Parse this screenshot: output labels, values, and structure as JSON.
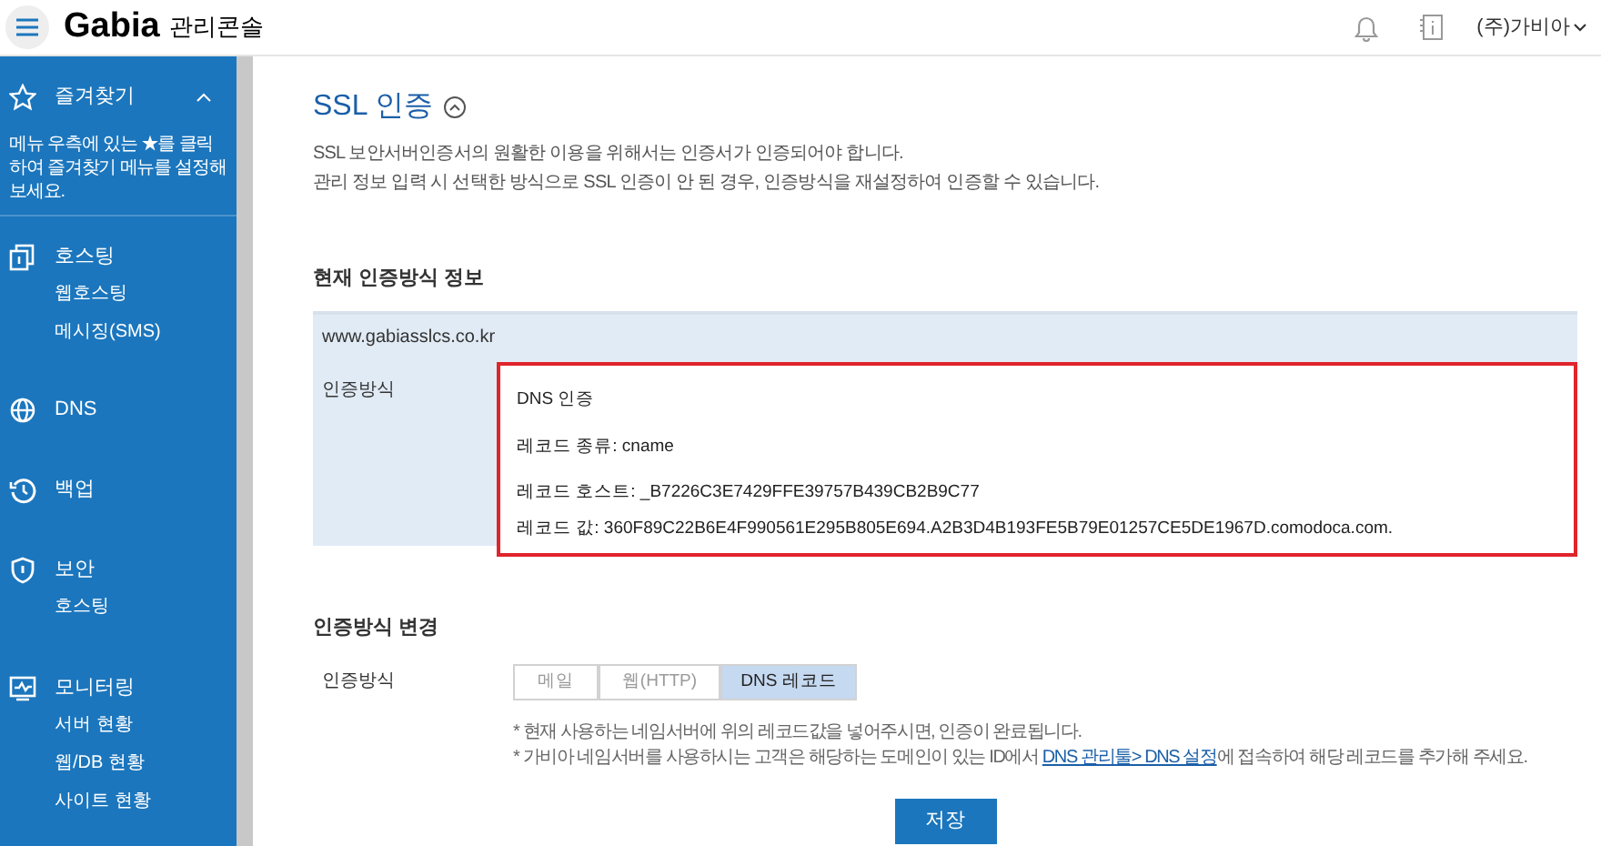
{
  "header": {
    "logo": "Gabia",
    "logo_sub": "관리콘솔",
    "account": "(주)가비아"
  },
  "sidebar": {
    "favorites": {
      "label": "즐겨찾기",
      "expanded": true,
      "hint": "메뉴 우측에 있는 ★를 클릭하여 즐겨찾기 메뉴를 설정해 보세요."
    },
    "sections": [
      {
        "label": "호스팅",
        "children": [
          {
            "label": "웹호스팅"
          },
          {
            "label": "메시징(SMS)"
          }
        ]
      },
      {
        "label": "DNS"
      },
      {
        "label": "백업"
      },
      {
        "label": "보안",
        "children": [
          {
            "label": "호스팅"
          }
        ]
      },
      {
        "label": "모니터링",
        "children": [
          {
            "label": "서버 현황"
          },
          {
            "label": "웹/DB 현황"
          },
          {
            "label": "사이트 현황"
          }
        ]
      }
    ]
  },
  "page": {
    "title": "SSL 인증",
    "expanded": true,
    "description": [
      "SSL 보안서버인증서의 원활한 이용을 위해서는 인증서가 인증되어야 합니다.",
      "관리 정보 입력 시 선택한 방식으로 SSL 인증이 안 된 경우, 인증방식을 재설정하여 인증할 수 있습니다."
    ]
  },
  "current": {
    "heading": "현재 인증방식 정보",
    "domain": "www.gabiasslcs.co.kr",
    "label": "인증방식",
    "lines": [
      "DNS 인증",
      "레코드 종류: cname",
      "레코드 호스트: _B7226C3E7429FFE39757B439CB2B9C77",
      "레코드 값: 360F89C22B6E4F990561E295B805E694.A2B3D4B193FE5B79E01257CE5DE1967D.comodoca.com."
    ]
  },
  "change": {
    "heading": "인증방식 변경",
    "label": "인증방식",
    "options": [
      {
        "label": "메일",
        "selected": false
      },
      {
        "label": "웹(HTTP)",
        "selected": false
      },
      {
        "label": "DNS 레코드",
        "selected": true
      }
    ],
    "notes": [
      {
        "text": "* 현재 사용하는 네임서버에 위의 레코드값을 넣어주시면, 인증이 완료됩니다."
      },
      {
        "text": "* 가비아 네임서버를 사용하시는 고객은 해당하는 도메인이 있는 ID에서 ",
        "link": "DNS 관리툴> DNS 설정",
        "after": "에 접속하여 해당 레코드를 추가해 주세요."
      }
    ]
  },
  "save_button": "저장"
}
